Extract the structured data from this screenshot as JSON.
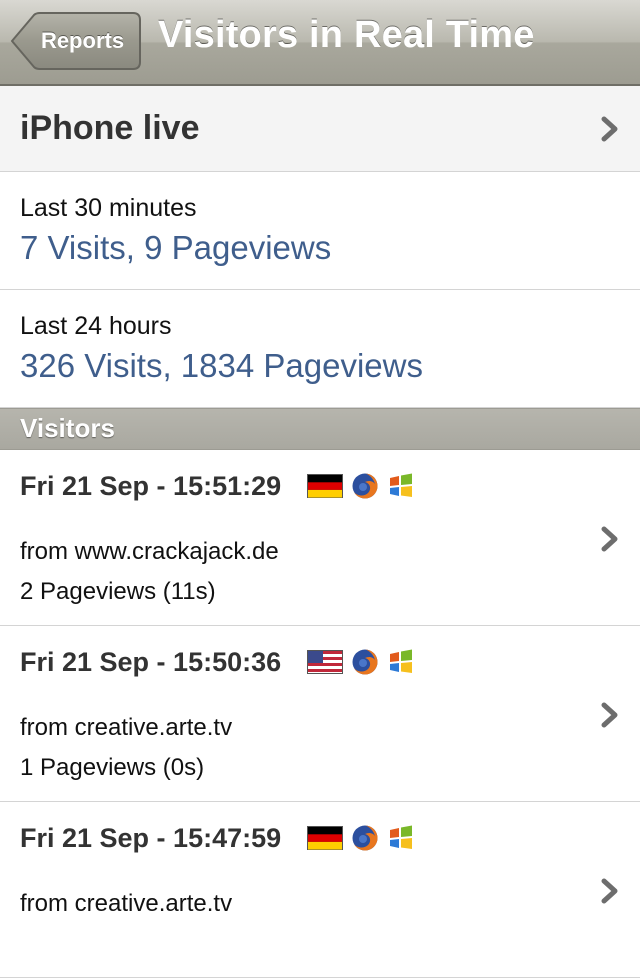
{
  "navbar": {
    "back_label": "Reports",
    "title": "Visitors in Real Time"
  },
  "site_row": {
    "label": "iPhone live"
  },
  "stats": [
    {
      "caption": "Last 30 minutes",
      "value": "7 Visits, 9 Pageviews"
    },
    {
      "caption": "Last 24 hours",
      "value": "326 Visits, 1834 Pageviews"
    }
  ],
  "section": {
    "title": "Visitors"
  },
  "visitors": [
    {
      "time": "Fri 21 Sep - 15:51:29",
      "flag": "germany-flag-icon",
      "browser": "firefox-icon",
      "os": "windows-icon",
      "from": "from www.crackajack.de",
      "views": "2 Pageviews (11s)"
    },
    {
      "time": "Fri 21 Sep - 15:50:36",
      "flag": "usa-flag-icon",
      "browser": "firefox-icon",
      "os": "windows-icon",
      "from": "from creative.arte.tv",
      "views": "1 Pageviews (0s)"
    },
    {
      "time": "Fri 21 Sep - 15:47:59",
      "flag": "germany-flag-icon",
      "browser": "firefox-icon",
      "os": "windows-icon",
      "from": "from creative.arte.tv",
      "views": ""
    }
  ],
  "colors": {
    "link_blue": "#3f5e8c",
    "navbar": "#b9b8ae",
    "section_header": "#aeada5"
  }
}
